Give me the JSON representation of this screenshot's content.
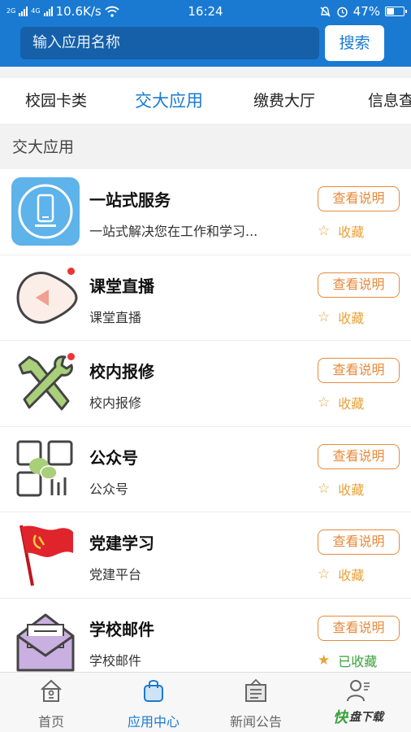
{
  "status_bar": {
    "signal_1": "2G",
    "signal_2": "4G",
    "net_speed": "10.6K/s",
    "time": "16:24",
    "battery": "47%",
    "battery_level": 0.47
  },
  "search": {
    "placeholder": "输入应用名称",
    "button_label": "搜索"
  },
  "tabs": [
    {
      "label": "校园卡类"
    },
    {
      "label": "交大应用"
    },
    {
      "label": "缴费大厅"
    },
    {
      "label": "信息查"
    }
  ],
  "active_tab": "交大应用",
  "section_title": "交大应用",
  "apps": [
    {
      "title": "一站式服务",
      "desc": "一站式解决您在工作和学习...",
      "btn": "查看说明",
      "fav": "收藏",
      "icon": "phone-icon",
      "favorited": false
    },
    {
      "title": "课堂直播",
      "desc": "课堂直播",
      "btn": "查看说明",
      "fav": "收藏",
      "icon": "play-icon",
      "favorited": false
    },
    {
      "title": "校内报修",
      "desc": "校内报修",
      "btn": "查看说明",
      "fav": "收藏",
      "icon": "wrench-hammer-icon",
      "favorited": false
    },
    {
      "title": "公众号",
      "desc": "公众号",
      "btn": "查看说明",
      "fav": "收藏",
      "icon": "qr-wechat-icon",
      "favorited": false
    },
    {
      "title": "党建学习",
      "desc": "党建平台",
      "btn": "查看说明",
      "fav": "收藏",
      "icon": "flag-icon",
      "favorited": false
    },
    {
      "title": "学校邮件",
      "desc": "学校邮件",
      "btn": "查看说明",
      "fav": "已收藏",
      "icon": "mail-icon",
      "favorited": true
    }
  ],
  "bottom_nav": [
    {
      "label": "首页",
      "icon": "home-icon"
    },
    {
      "label": "应用中心",
      "icon": "bag-icon"
    },
    {
      "label": "新闻公告",
      "icon": "news-icon"
    },
    {
      "label": "",
      "icon": "user-icon"
    }
  ],
  "watermark": {
    "text_1": "快",
    "text_2": "盘下载"
  },
  "colors": {
    "brand": "#1a7ad2",
    "orange": "#e8893a",
    "green": "#3aa23a",
    "star": "#e8a23a"
  }
}
